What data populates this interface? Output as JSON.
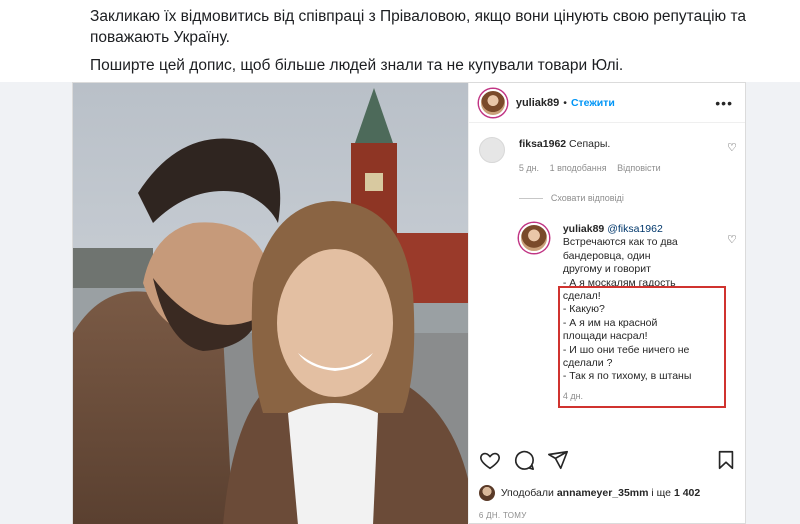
{
  "post": {
    "paragraph1": "Закликаю їх відмовитись від співпраці з Пріваловою, якщо вони цінують свою репутацію та поважають Україну.",
    "paragraph2": "Поширте цей допис, щоб більше людей знали та не купували товари Юлі."
  },
  "instagram": {
    "header": {
      "username": "yuliak89",
      "separator": "•",
      "follow_label": "Стежити",
      "more_icon": "more-horizontal-icon"
    },
    "comment": {
      "username": "fiksa1962",
      "text": "Сепары.",
      "time": "5 дн.",
      "likes": "1 вподобання",
      "reply_label": "Відповісти"
    },
    "hide_replies_label": "Сховати відповіді",
    "reply": {
      "username": "yuliak89",
      "mention": "@fiksa1962",
      "lines": [
        "Встречаются как то два",
        "бандеровца, один",
        "другому и говорит",
        "- А я москалям гадость",
        "сделал!",
        "- Какую?",
        "- А я им на красной",
        "площади насрал!",
        "- И шо они тебе ничего не",
        "сделали ?",
        "- Так я по тихому, в штаны"
      ],
      "time": "4 дн."
    },
    "likes_prefix": "Уподобали",
    "likes_user": "annameyer_35mm",
    "likes_middle": "і ще",
    "likes_count": "1 402",
    "time_ago": "6 ДН. ТОМУ",
    "accent": "#0095f6",
    "highlight_color": "#d0332f"
  }
}
